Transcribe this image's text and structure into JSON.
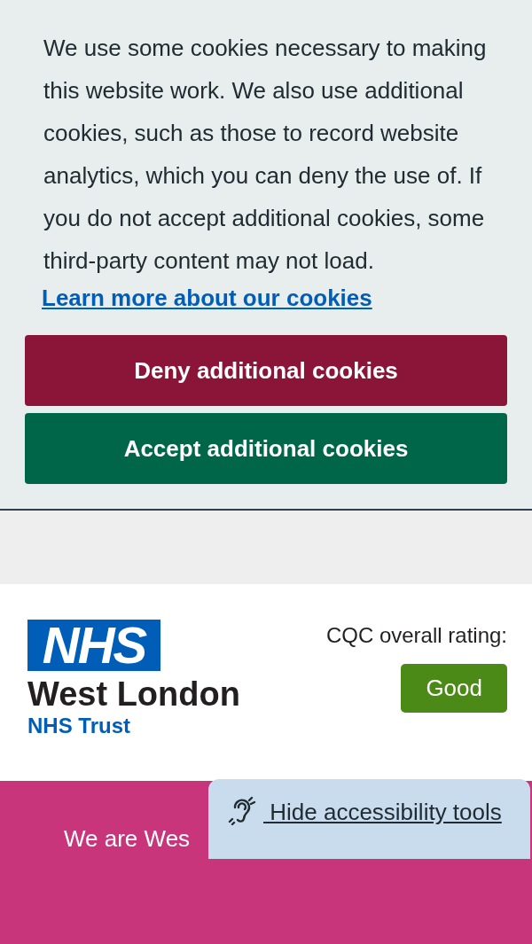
{
  "cookie_banner": {
    "message": "We use some cookies necessary to making this website work. We also use additional cookies, such as those to record website analytics, which you can deny the use of. If you do not accept additional cookies, some third-party content may not load.",
    "link": "Learn more about our cookies",
    "buttons": [
      {
        "label": "Deny additional cookies",
        "kind": "deny"
      },
      {
        "label": "Accept additional cookies",
        "kind": "accept"
      }
    ]
  },
  "header": {
    "logo": {
      "mark": "NHS",
      "name": "West London",
      "subtitle": "NHS Trust"
    },
    "rating_label": "CQC overall rating:",
    "rating": "Good"
  },
  "hero": {
    "text": "We are Wes"
  },
  "accessibility_tab": {
    "label": " Hide accessibility tools"
  }
}
